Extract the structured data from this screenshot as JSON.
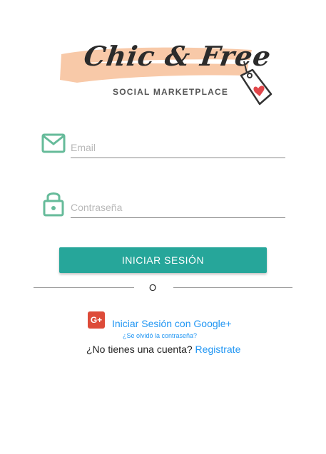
{
  "brand": {
    "name": "Chic & Free",
    "tagline": "SOCIAL MARKETPLACE",
    "brush_color": "#f8c9a8",
    "tag_icon": "price-tag-heart-icon"
  },
  "form": {
    "email": {
      "placeholder": "Email",
      "icon": "envelope-icon"
    },
    "password": {
      "placeholder": "Contraseña",
      "icon": "padlock-icon"
    },
    "icon_color": "#66bb9a",
    "submit_label": "INICIAR SESIÓN",
    "submit_color": "#26a69a"
  },
  "divider": {
    "text": "O"
  },
  "social": {
    "google_badge": "G+",
    "google_label": "Iniciar Sesión con Google+",
    "google_color": "#dd4b39"
  },
  "links": {
    "forgot_password": "¿Se olvidó la contraseña?",
    "no_account_text": "¿No tienes una cuenta?",
    "register_label": "Registrate",
    "link_color": "#2196f3"
  }
}
